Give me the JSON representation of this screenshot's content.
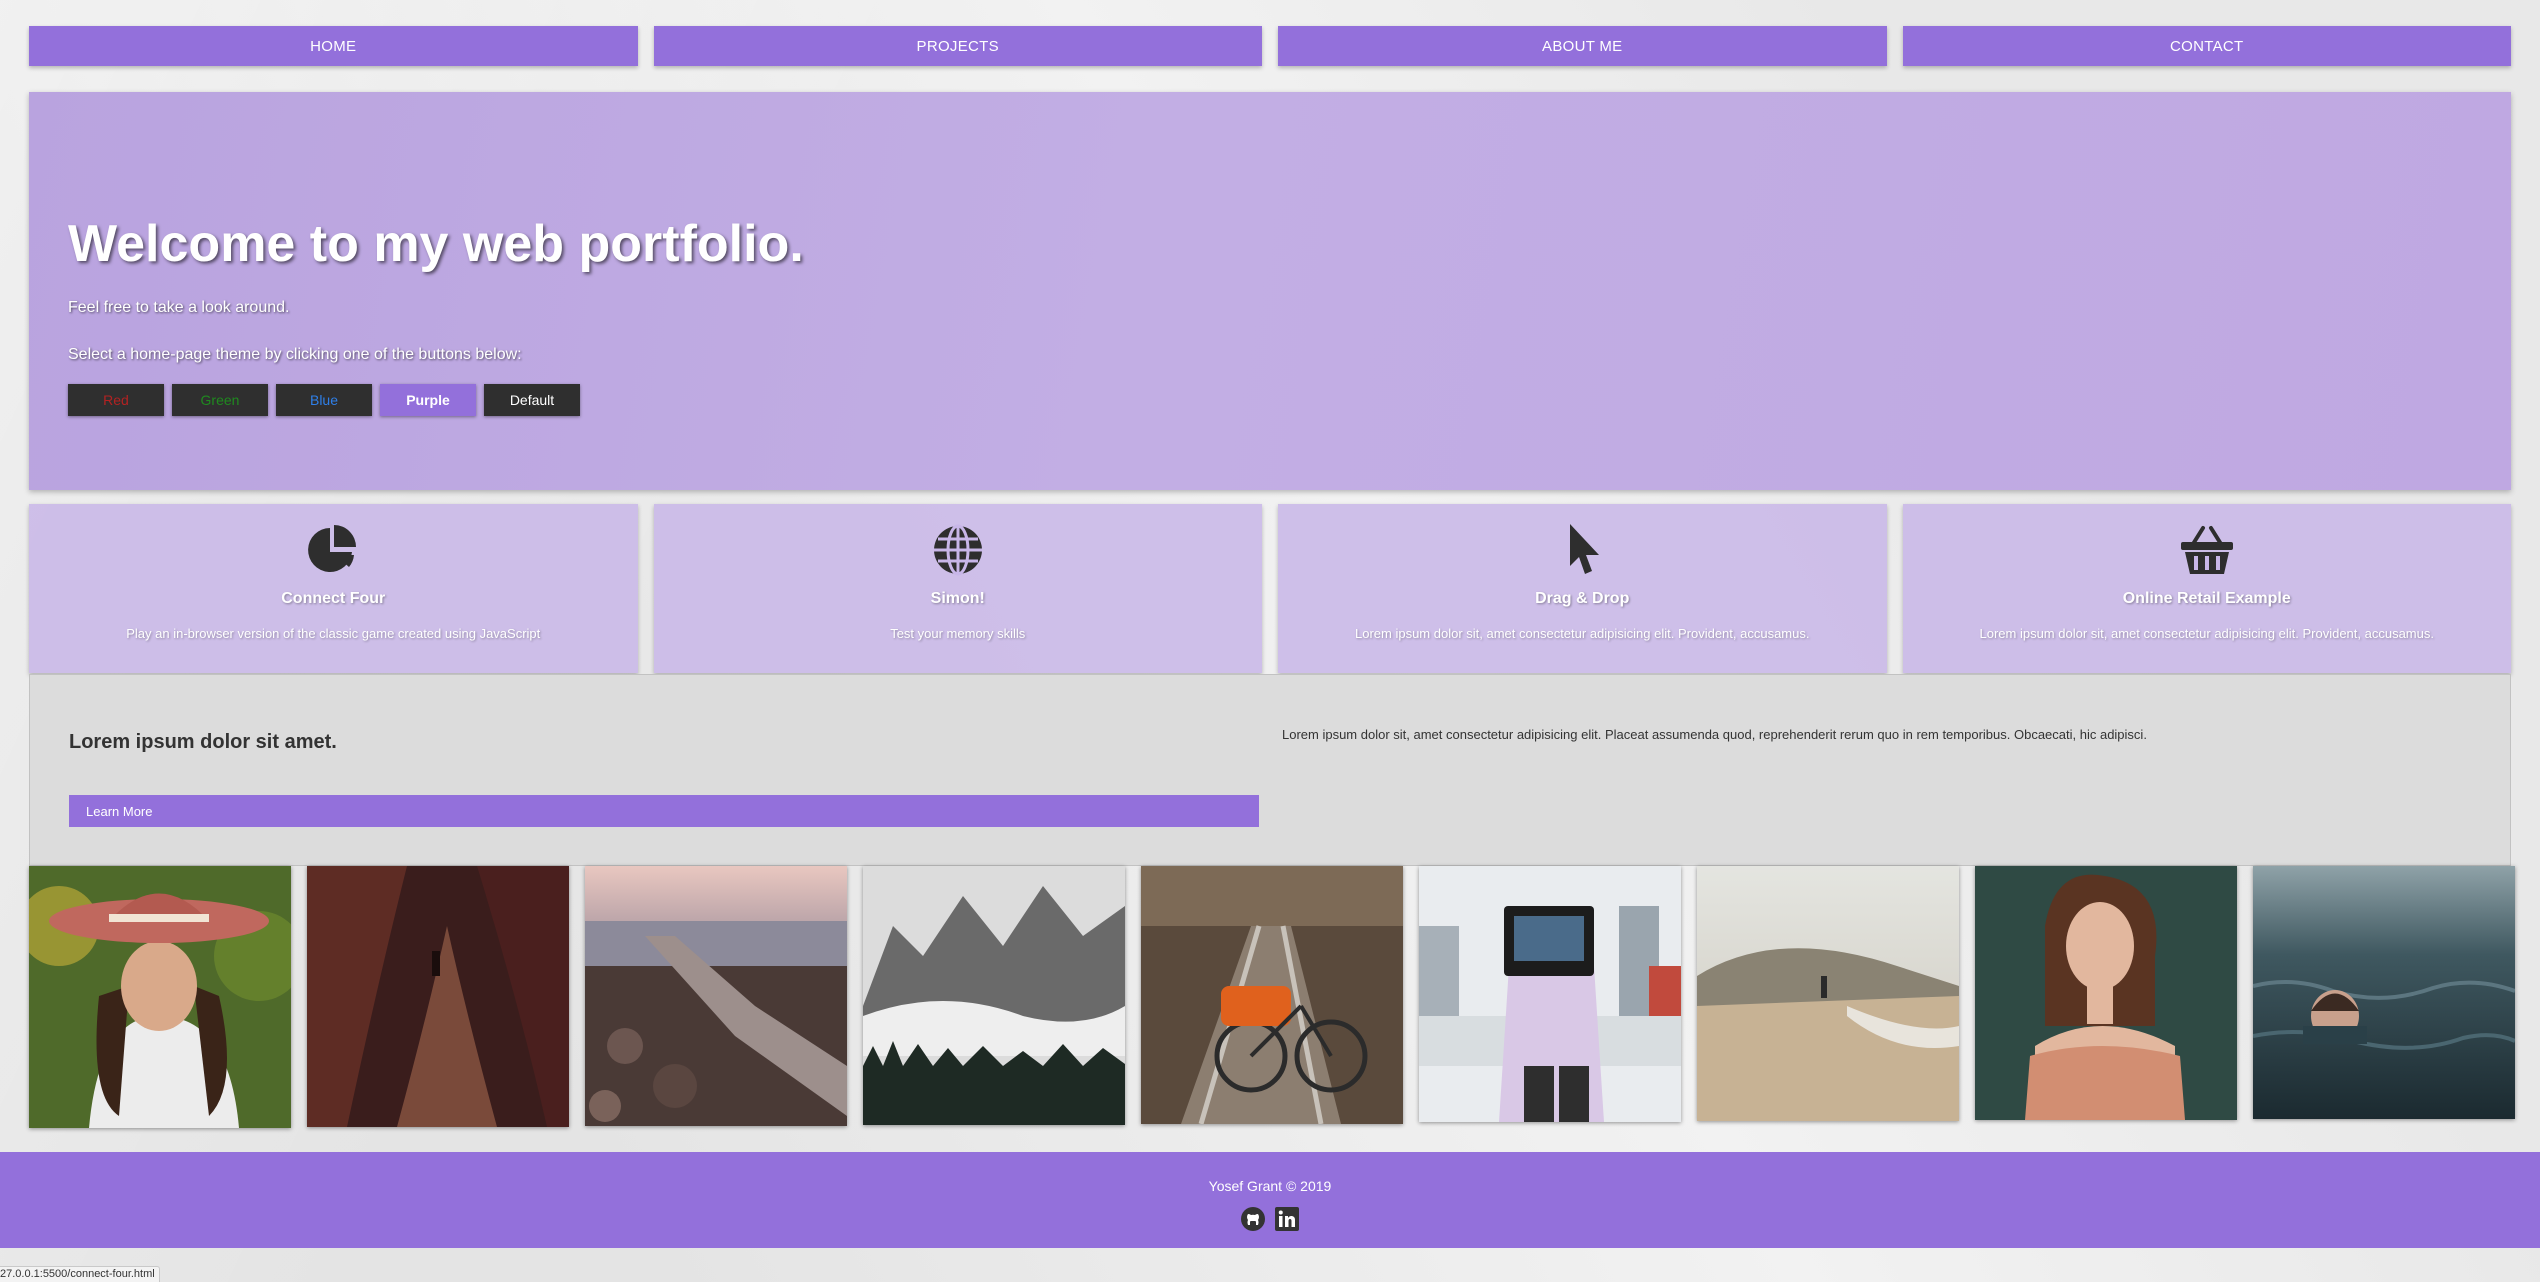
{
  "nav": {
    "items": [
      {
        "label": "HOME"
      },
      {
        "label": "PROJECTS"
      },
      {
        "label": "ABOUT ME"
      },
      {
        "label": "CONTACT"
      }
    ]
  },
  "hero": {
    "title": "Welcome to my web portfolio.",
    "subtitle": "Feel free to take a look around.",
    "instruction": "Select a home-page theme by clicking one of the buttons below:",
    "themes": [
      {
        "label": "Red"
      },
      {
        "label": "Green"
      },
      {
        "label": "Blue"
      },
      {
        "label": "Purple"
      },
      {
        "label": "Default"
      }
    ]
  },
  "projects": [
    {
      "title": "Connect Four",
      "description": "Play an in-browser version of the classic game created using JavaScript",
      "icon": "pie-chart-icon"
    },
    {
      "title": "Simon!",
      "description": "Test your memory skills",
      "icon": "globe-icon"
    },
    {
      "title": "Drag & Drop",
      "description": "Lorem ipsum dolor sit, amet consectetur adipisicing elit. Provident, accusamus.",
      "icon": "cursor-icon"
    },
    {
      "title": "Online Retail Example",
      "description": "Lorem ipsum dolor sit, amet consectetur adipisicing elit. Provident, accusamus.",
      "icon": "basket-icon"
    }
  ],
  "info": {
    "title": "Lorem ipsum dolor sit amet.",
    "button": "Learn More",
    "text": "Lorem ipsum dolor sit, amet consectetur adipisicing elit. Placeat assumenda quod, reprehenderit rerum quo in rem temporibus. Obcaecati, hic adipisci."
  },
  "footer": {
    "copyright": "Yosef Grant © 2019",
    "icons": [
      "github-icon",
      "linkedin-icon"
    ]
  },
  "status_bar": {
    "url": "27.0.0.1:5500/connect-four.html"
  },
  "colors": {
    "accent": "#9370db",
    "hero_bg": "#bea8e2",
    "card_bg": "#c8b6e8",
    "info_bg": "#dcdcdc"
  }
}
